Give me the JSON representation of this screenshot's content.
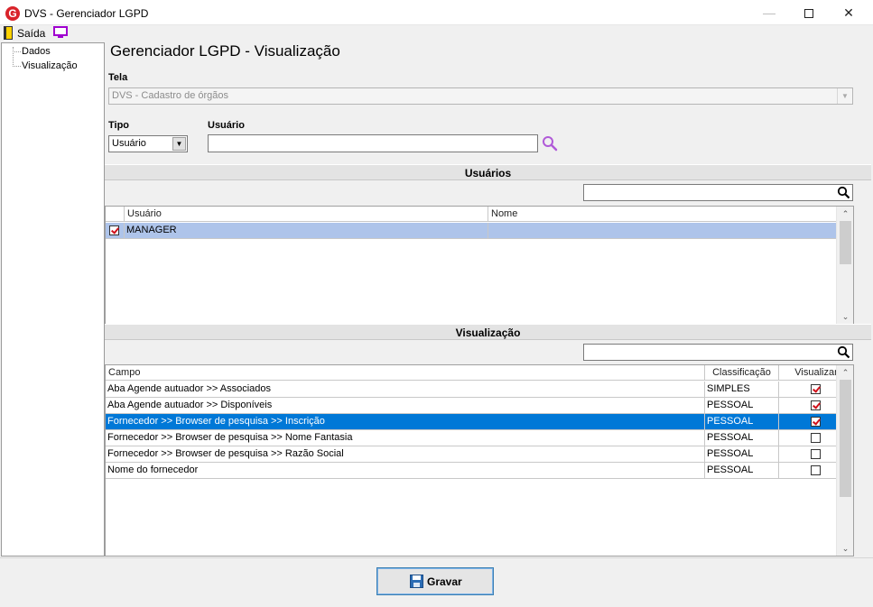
{
  "window": {
    "title": "DVS - Gerenciador LGPD",
    "app_icon_letter": "G",
    "minimize_glyph": "—",
    "close_glyph": "✕"
  },
  "menu": {
    "exit_label": "Saída"
  },
  "tree": {
    "items": [
      "Dados",
      "Visualização"
    ]
  },
  "main": {
    "title": "Gerenciador LGPD - Visualização",
    "tela": {
      "label": "Tela",
      "value": "DVS - Cadastro de órgãos"
    },
    "tipo": {
      "label": "Tipo",
      "value": "Usuário"
    },
    "usuario": {
      "label": "Usuário",
      "value": ""
    }
  },
  "users_section": {
    "header": "Usuários",
    "filter_value": "",
    "columns": [
      "Usuário",
      "Nome"
    ],
    "rows": [
      {
        "checked": true,
        "usuario": "MANAGER",
        "nome": ""
      }
    ]
  },
  "view_section": {
    "header": "Visualização",
    "filter_value": "",
    "columns": [
      "Campo",
      "Classificação",
      "Visualizar"
    ],
    "rows": [
      {
        "campo": "Aba Agende autuador >> Associados",
        "classificacao": "SIMPLES",
        "visualizar": true
      },
      {
        "campo": "Aba Agende autuador >> Disponíveis",
        "classificacao": "PESSOAL",
        "visualizar": true
      },
      {
        "campo": "Fornecedor >> Browser de pesquisa >> Inscrição",
        "classificacao": "PESSOAL",
        "visualizar": true
      },
      {
        "campo": "Fornecedor >> Browser de pesquisa >> Nome Fantasia",
        "classificacao": "PESSOAL",
        "visualizar": false
      },
      {
        "campo": "Fornecedor >> Browser de pesquisa >> Razão Social",
        "classificacao": "PESSOAL",
        "visualizar": false
      },
      {
        "campo": "Nome do fornecedor",
        "classificacao": "PESSOAL",
        "visualizar": false
      }
    ],
    "selected_row": 2
  },
  "footer": {
    "save_label": "Gravar"
  },
  "colors": {
    "selection_light": "#aec4ea",
    "selection_strong": "#0078d7",
    "checkbox_mark": "#d0101a",
    "app_icon": "#d9232a"
  },
  "icons": [
    "exit-door-icon",
    "monitor-icon",
    "search-icon",
    "disk-icon"
  ]
}
